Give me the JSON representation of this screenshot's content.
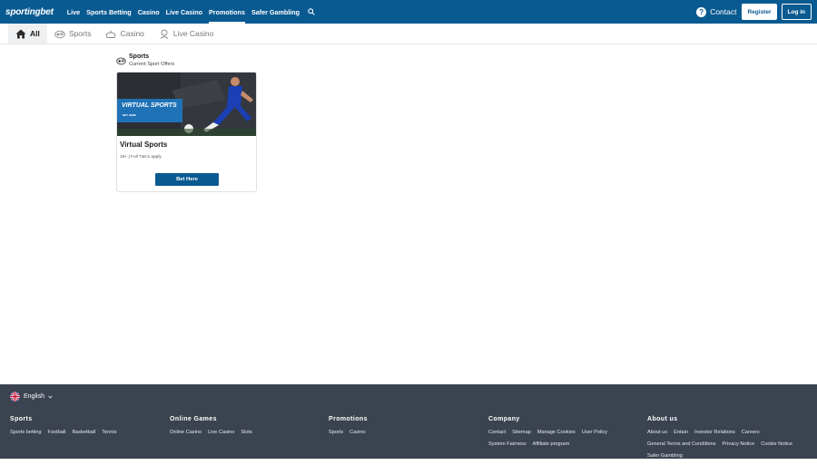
{
  "header": {
    "logo": "sportingbet",
    "nav": [
      "Live",
      "Sports Betting",
      "Casino",
      "Live Casino",
      "Promotions",
      "Safer Gambling"
    ],
    "active_nav": "Promotions",
    "contact": "Contact",
    "register": "Register",
    "login": "Log in"
  },
  "tabs": [
    {
      "label": "All",
      "icon": "home-icon"
    },
    {
      "label": "Sports",
      "icon": "sports-icon"
    },
    {
      "label": "Casino",
      "icon": "casino-icon"
    },
    {
      "label": "Live Casino",
      "icon": "live-casino-icon"
    }
  ],
  "section": {
    "title": "Sports",
    "subtitle": "Current Sport Offers"
  },
  "card": {
    "banner_title": "VIRTUAL SPORTS",
    "banner_sub": "BET HERE",
    "title": "Virtual Sports",
    "terms": "18+ | Full T&Cs apply",
    "button": "Bet Here"
  },
  "footer": {
    "language": "English",
    "columns": [
      {
        "title": "Sports",
        "links": [
          "Sports betting",
          "Football",
          "Basketball",
          "Tennis"
        ]
      },
      {
        "title": "Online Games",
        "links": [
          "Online Casino",
          "Live Casino",
          "Slots"
        ]
      },
      {
        "title": "Promotions",
        "links": [
          "Sports",
          "Casino"
        ]
      },
      {
        "title": "Company",
        "links": [
          "Contact",
          "Sitemap",
          "Manage Cookies",
          "User Policy",
          "System Fairness",
          "Affiliate program"
        ]
      },
      {
        "title": "About us",
        "links": [
          "About us",
          "Entain",
          "Investor Relations",
          "Careers",
          "General Terms and Conditions",
          "Privacy Notice",
          "Cookie Notice",
          "Safer Gambling"
        ]
      }
    ]
  },
  "colors": {
    "brand": "#0a5a92",
    "footer": "#3b4350"
  }
}
